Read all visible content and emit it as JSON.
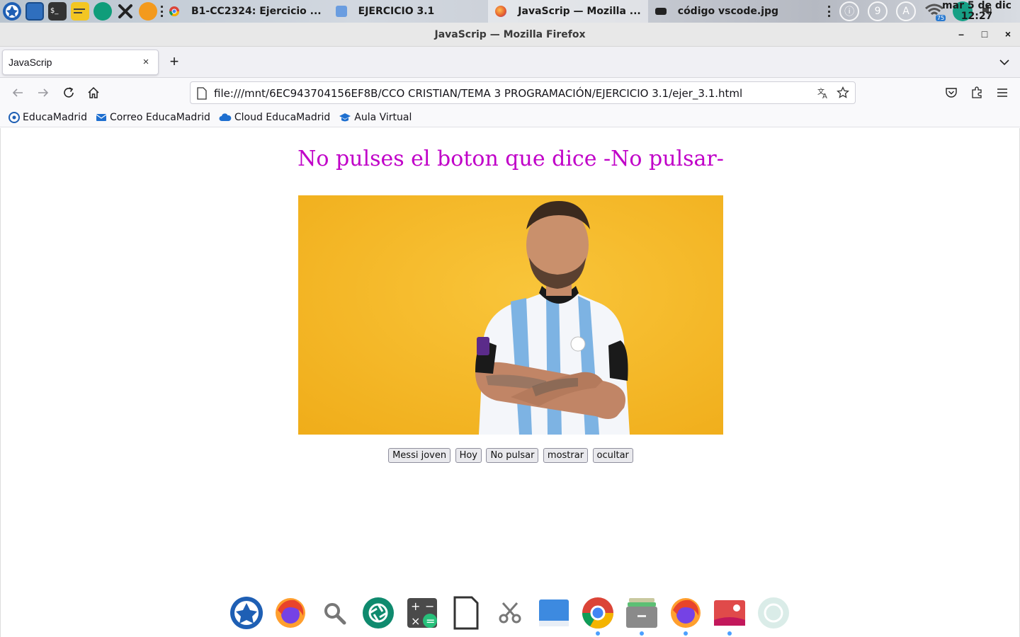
{
  "top_panel": {
    "tasks": [
      {
        "label": "B1-CC2324: Ejercicio ..."
      },
      {
        "label": "EJERCICIO 3.1"
      },
      {
        "label": "JavaScrip — Mozilla ..."
      },
      {
        "label": "código vscode.jpg"
      }
    ],
    "tray": {
      "update_badge": "9",
      "account_letter": "A",
      "wifi_badge": "75"
    },
    "clock": {
      "date": "mar  5 de dic",
      "time": "12:27"
    }
  },
  "window": {
    "title": "JavaScrip — Mozilla Firefox",
    "minimize": "–",
    "maximize": "□",
    "close": "×"
  },
  "tab": {
    "title": "JavaScrip",
    "close": "×",
    "new_tab": "+"
  },
  "navbar": {
    "url": "file:///mnt/6EC943704156EF8B/CCO CRISTIAN/TEMA 3 PROGRAMACIÓN/EJERCICIO 3.1/ejer_3.1.html"
  },
  "bookmarks": [
    {
      "label": "EducaMadrid",
      "icon": "educamadrid-icon"
    },
    {
      "label": "Correo EducaMadrid",
      "icon": "mail-icon"
    },
    {
      "label": "Cloud EducaMadrid",
      "icon": "cloud-icon"
    },
    {
      "label": "Aula Virtual",
      "icon": "graduation-cap-icon"
    }
  ],
  "page": {
    "heading": "No pulses el boton que dice -No pulsar-",
    "heading_color": "#c000c8",
    "image_background": "#f5b521",
    "buttons": [
      {
        "label": "Messi joven"
      },
      {
        "label": "Hoy"
      },
      {
        "label": "No pulsar"
      },
      {
        "label": "mostrar"
      },
      {
        "label": "ocultar"
      }
    ]
  },
  "dock": {
    "items": [
      "educamadrid-icon",
      "firefox-icon",
      "search-icon",
      "shutter-icon",
      "calculator-icon",
      "document-icon",
      "scissors-icon",
      "window-icon",
      "chrome-icon",
      "archive-icon",
      "firefox-icon",
      "image-viewer-icon",
      "shutter-icon"
    ]
  }
}
